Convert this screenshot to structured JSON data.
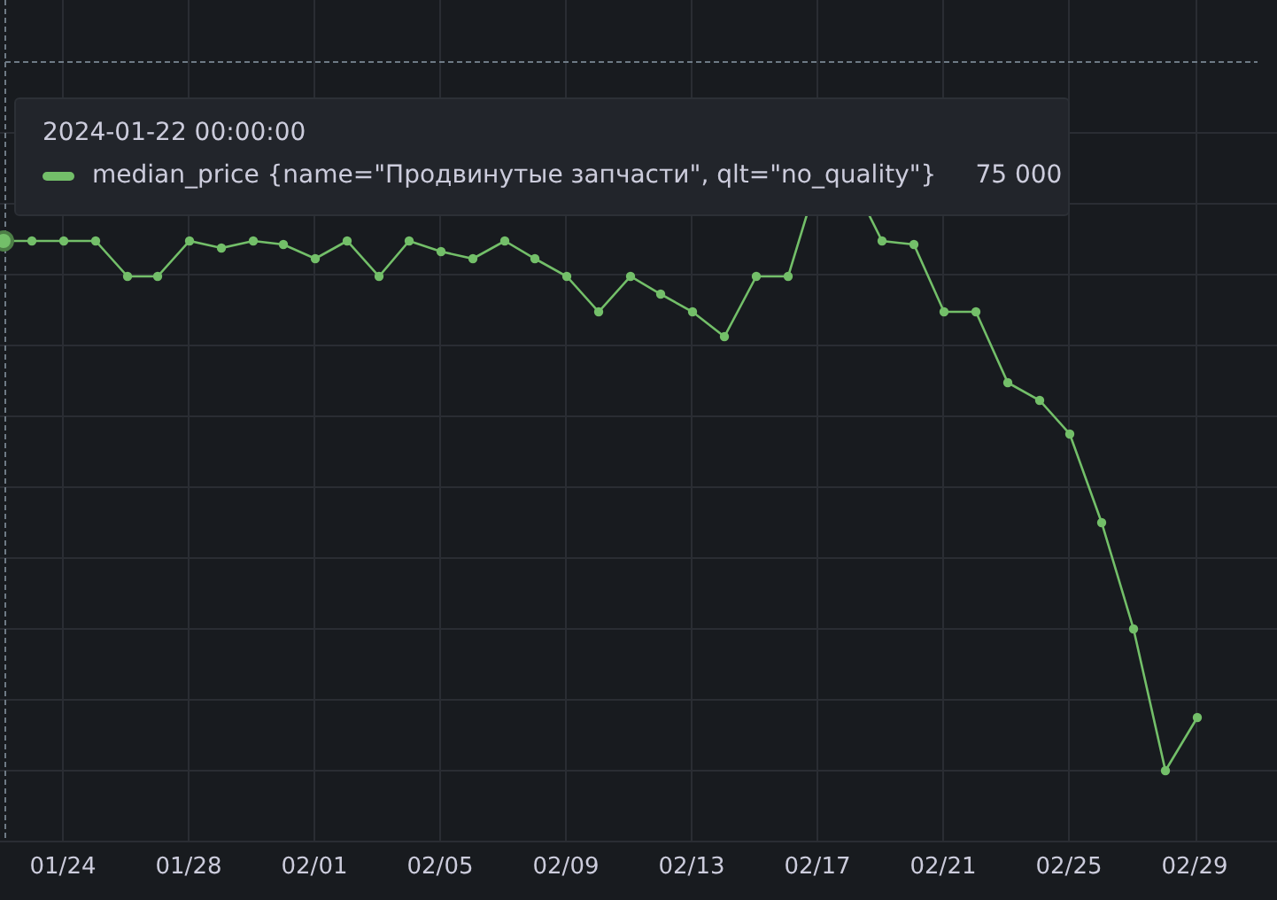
{
  "tooltip": {
    "time": "2024-01-22 00:00:00",
    "series": "median_price {name=\"Продвинутые запчасти\", qlt=\"no_quality\"}",
    "value": "75 000"
  },
  "x_axis": {
    "ticks": [
      "01/24",
      "01/28",
      "02/01",
      "02/05",
      "02/09",
      "02/13",
      "02/17",
      "02/21",
      "02/25",
      "02/29"
    ]
  }
}
